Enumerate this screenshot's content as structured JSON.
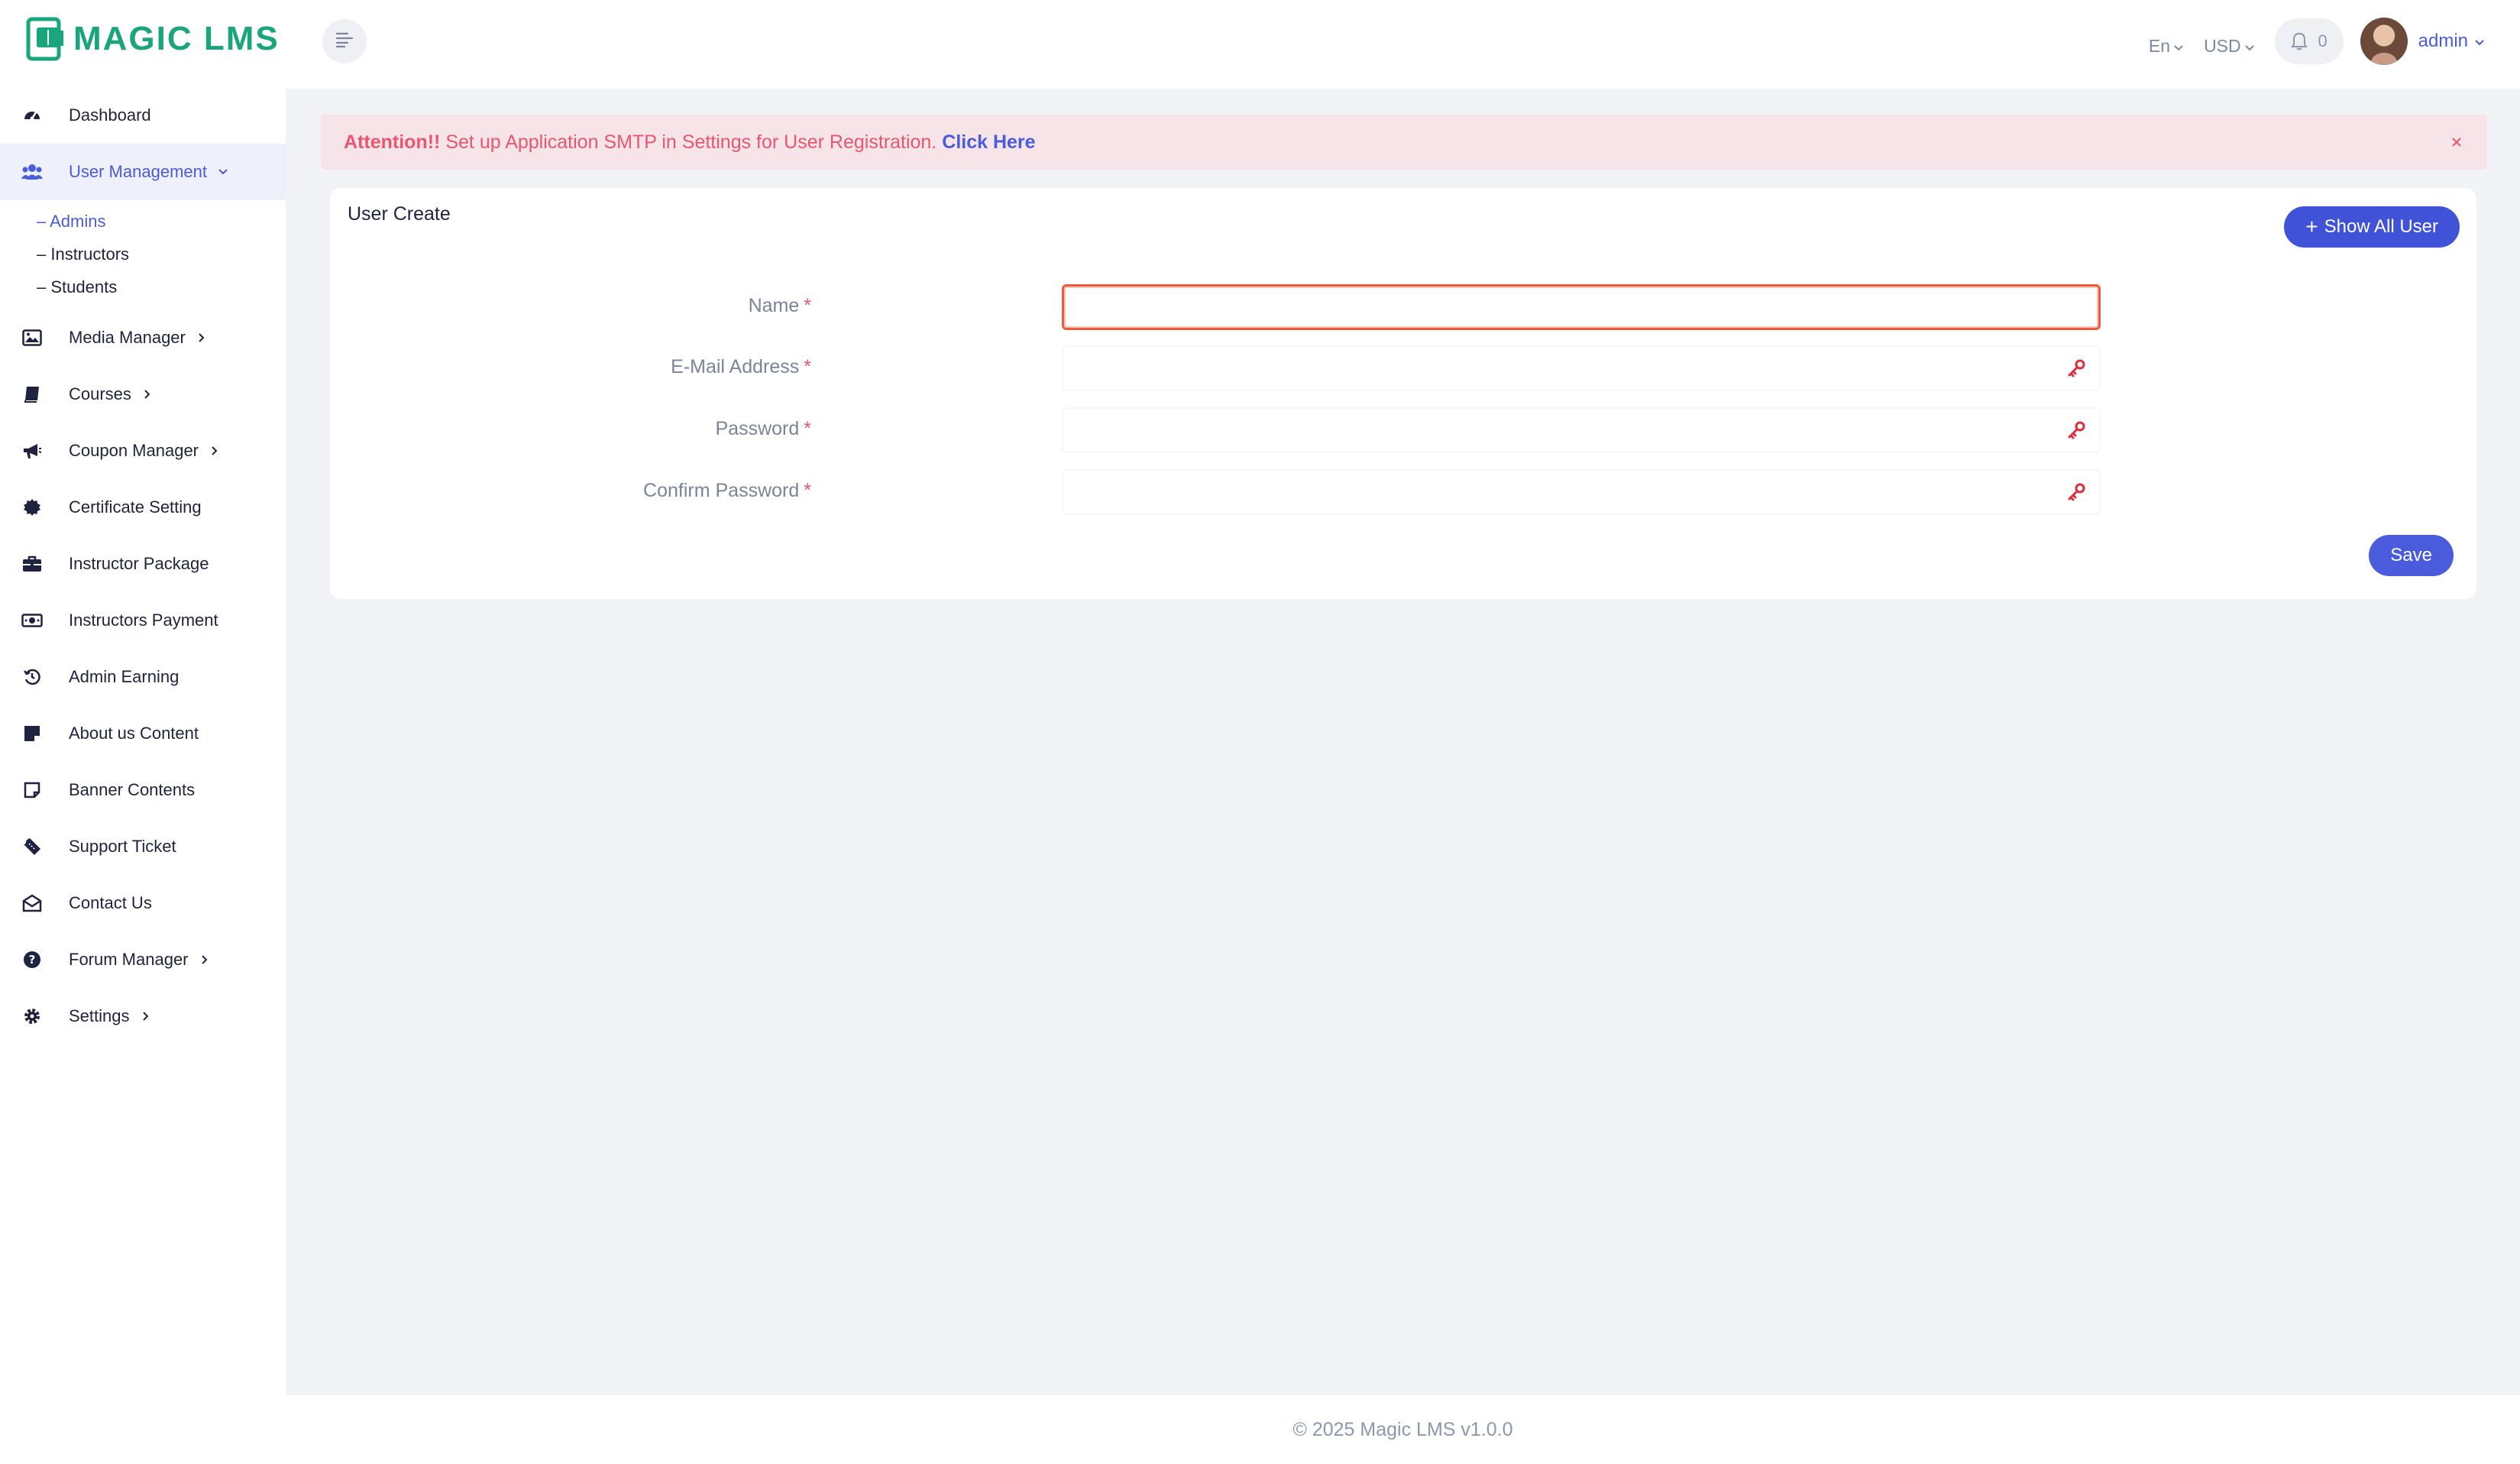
{
  "app": {
    "logo_text": "MAGIC LMS",
    "brand_color": "#1aa67c",
    "accent_color": "#4a5bdc"
  },
  "sidebar": {
    "items": [
      {
        "label": "Dashboard",
        "icon": "dashboard-icon"
      },
      {
        "label": "User Management",
        "icon": "users-icon",
        "active": true,
        "expanded": true
      },
      {
        "label": "Media Manager",
        "icon": "image-icon"
      },
      {
        "label": "Courses",
        "icon": "book-icon"
      },
      {
        "label": "Coupon Manager",
        "icon": "megaphone-icon"
      },
      {
        "label": "Certificate Setting",
        "icon": "certificate-icon"
      },
      {
        "label": "Instructor Package",
        "icon": "briefcase-icon"
      },
      {
        "label": "Instructors Payment",
        "icon": "money-icon"
      },
      {
        "label": "Admin Earning",
        "icon": "history-icon"
      },
      {
        "label": "About us Content",
        "icon": "note-icon"
      },
      {
        "label": "Banner Contents",
        "icon": "sticky-note-icon"
      },
      {
        "label": "Support Ticket",
        "icon": "ticket-icon"
      },
      {
        "label": "Contact Us",
        "icon": "envelope-icon"
      },
      {
        "label": "Forum Manager",
        "icon": "question-icon"
      },
      {
        "label": "Settings",
        "icon": "gear-icon"
      }
    ],
    "submenu": [
      {
        "label": "– Admins",
        "active": true
      },
      {
        "label": "– Instructors"
      },
      {
        "label": "– Students"
      }
    ]
  },
  "header": {
    "language": "En",
    "currency": "USD",
    "notification_count": "0",
    "username": "admin"
  },
  "alert": {
    "strong": "Attention!!",
    "message": "Set up Application SMTP in Settings for User Registration.",
    "link": "Click Here",
    "color": "#e8566f"
  },
  "card": {
    "title": "User Create",
    "show_all_label": "Show All User",
    "fields": [
      {
        "label": "Name",
        "required": "*",
        "value": ""
      },
      {
        "label": "E-Mail Address",
        "required": "*",
        "value": ""
      },
      {
        "label": "Password",
        "required": "*",
        "value": ""
      },
      {
        "label": "Confirm Password",
        "required": "*",
        "value": ""
      }
    ],
    "save_label": "Save"
  },
  "footer": {
    "text": "© 2025 Magic LMS v1.0.0"
  }
}
